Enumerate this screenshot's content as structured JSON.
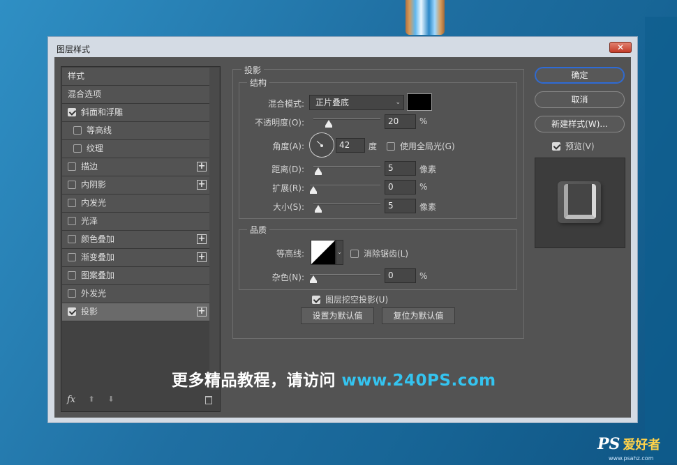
{
  "window": {
    "title": "图层样式",
    "close_label": "✕"
  },
  "style_list": {
    "items": [
      {
        "label": "样式",
        "checkbox": false,
        "checked": false,
        "plus": false,
        "indent": false,
        "selected": false
      },
      {
        "label": "混合选项",
        "checkbox": false,
        "checked": false,
        "plus": false,
        "indent": false,
        "selected": false
      },
      {
        "label": "斜面和浮雕",
        "checkbox": true,
        "checked": true,
        "plus": false,
        "indent": false,
        "selected": false
      },
      {
        "label": "等高线",
        "checkbox": true,
        "checked": false,
        "plus": false,
        "indent": true,
        "selected": false
      },
      {
        "label": "纹理",
        "checkbox": true,
        "checked": false,
        "plus": false,
        "indent": true,
        "selected": false
      },
      {
        "label": "描边",
        "checkbox": true,
        "checked": false,
        "plus": true,
        "indent": false,
        "selected": false
      },
      {
        "label": "内阴影",
        "checkbox": true,
        "checked": false,
        "plus": true,
        "indent": false,
        "selected": false
      },
      {
        "label": "内发光",
        "checkbox": true,
        "checked": false,
        "plus": false,
        "indent": false,
        "selected": false
      },
      {
        "label": "光泽",
        "checkbox": true,
        "checked": false,
        "plus": false,
        "indent": false,
        "selected": false
      },
      {
        "label": "颜色叠加",
        "checkbox": true,
        "checked": false,
        "plus": true,
        "indent": false,
        "selected": false
      },
      {
        "label": "渐变叠加",
        "checkbox": true,
        "checked": false,
        "plus": true,
        "indent": false,
        "selected": false
      },
      {
        "label": "图案叠加",
        "checkbox": true,
        "checked": false,
        "plus": false,
        "indent": false,
        "selected": false
      },
      {
        "label": "外发光",
        "checkbox": true,
        "checked": false,
        "plus": false,
        "indent": false,
        "selected": false
      },
      {
        "label": "投影",
        "checkbox": true,
        "checked": true,
        "plus": true,
        "indent": false,
        "selected": true
      }
    ],
    "plus_glyph": "+",
    "fx_label": "fx",
    "up_glyph": "⬆",
    "down_glyph": "⬇"
  },
  "drop_shadow": {
    "group_title": "投影",
    "structure": {
      "title": "结构",
      "blend_mode_label": "混合模式:",
      "blend_mode_value": "正片叠底",
      "shadow_color": "#000000",
      "opacity_label": "不透明度(O):",
      "opacity_value": "20",
      "opacity_unit": "%",
      "opacity_fraction": 0.2,
      "angle_label": "角度(A):",
      "angle_value": "42",
      "angle_unit": "度",
      "global_light_label": "使用全局光(G)",
      "global_light_checked": false,
      "distance_label": "距离(D):",
      "distance_value": "5",
      "distance_unit": "像素",
      "distance_fraction": 0.02,
      "spread_label": "扩展(R):",
      "spread_value": "0",
      "spread_unit": "%",
      "spread_fraction": 0.0,
      "size_label": "大小(S):",
      "size_value": "5",
      "size_unit": "像素",
      "size_fraction": 0.02
    },
    "quality": {
      "title": "品质",
      "contour_label": "等高线:",
      "anti_alias_label": "消除锯齿(L)",
      "anti_alias_checked": false,
      "noise_label": "杂色(N):",
      "noise_value": "0",
      "noise_unit": "%",
      "noise_fraction": 0.0
    },
    "knockout_label": "图层挖空投影(U)",
    "knockout_checked": true,
    "make_default_label": "设置为默认值",
    "reset_default_label": "复位为默认值"
  },
  "actions": {
    "ok_label": "确定",
    "cancel_label": "取消",
    "new_style_label": "新建样式(W)...",
    "preview_label": "预览(V)",
    "preview_checked": true
  },
  "overlay": {
    "watermark_text": "更多精品教程，请访问 ",
    "watermark_url": "www.240PS.com",
    "corner_logo_latin": "PS",
    "corner_logo_cn": "爱好者",
    "corner_site": "www.psahz.com"
  },
  "colors": {
    "accent_default_button": "#2e6bd6",
    "watermark_url": "#34c4f0"
  }
}
